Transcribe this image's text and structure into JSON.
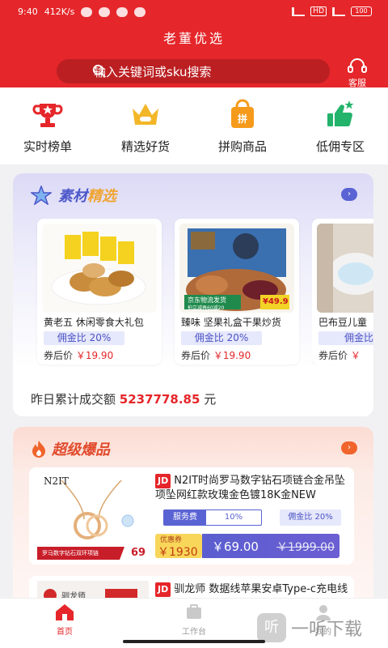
{
  "status": {
    "time": "9:40",
    "speed": "412K/s",
    "battery": "100"
  },
  "header": {
    "title": "老董优选",
    "search_placeholder": "输入关键词或sku搜索",
    "service_label": "客服"
  },
  "categories": [
    {
      "label": "实时榜单",
      "icon": "trophy-icon",
      "color": "#e5262a"
    },
    {
      "label": "精选好货",
      "icon": "crown-icon",
      "color": "#f3b628"
    },
    {
      "label": "拼购商品",
      "icon": "shopping-bag-icon",
      "color": "#f59a1b"
    },
    {
      "label": "低佣专区",
      "icon": "thumbs-up-icon",
      "color": "#23b36b"
    }
  ],
  "material": {
    "title_part1": "素材",
    "title_part2": "精选",
    "products": [
      {
        "name": "黄老五 休闲零食大礼包",
        "rate": "佣金比 20%",
        "price_label": "券后价",
        "price": "￥19.90"
      },
      {
        "name": "臻味 坚果礼盒干果炒货",
        "rate": "佣金比 20%",
        "price_label": "券后价",
        "price": "￥19.90",
        "img_text1": "京东物流发货",
        "img_text2": "拍立减再60减20",
        "img_tag": "¥49.9"
      },
      {
        "name": "巴布豆儿童",
        "rate": "佣金比",
        "price_label": "券后价",
        "price": "￥"
      }
    ],
    "yesterday_label": "昨日累计成交额",
    "yesterday_value": "5237778.85",
    "yesterday_unit": "元"
  },
  "hot": {
    "title": "超级爆品",
    "items": [
      {
        "tag": "JD",
        "title": "N2IT时尚罗马数字钻石项链合金吊坠项坠网红款玫瑰金色镀18K金NEW",
        "service_label": "服务费",
        "service_value": "10%",
        "rate": "佣金比 20%",
        "coupon_label": "优惠券",
        "coupon_value": "￥1930",
        "price_now": "￥69.00",
        "price_old": "￥1999.00",
        "img_brand": "N2IT",
        "img_caption": "罗马数字钻石双环项链",
        "img_price": "69"
      },
      {
        "tag": "JD",
        "title": "驯龙师 数据线苹果安卓Type-c充电线",
        "img_brand": "驯龙师"
      }
    ]
  },
  "nav": [
    {
      "label": "首页",
      "icon": "home-icon"
    },
    {
      "label": "工作台",
      "icon": "workbench-icon"
    },
    {
      "label": "我的",
      "icon": "user-icon"
    }
  ],
  "watermark": {
    "text": "一听下载",
    "icon_text": "听"
  }
}
